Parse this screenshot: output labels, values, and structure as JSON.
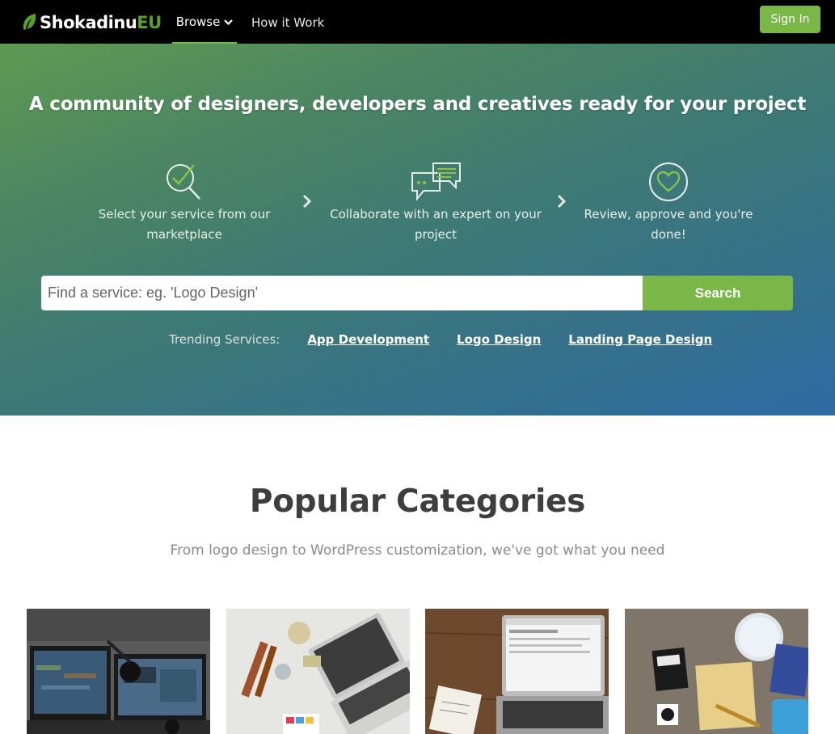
{
  "nav": {
    "logo_main": "Shokadinu",
    "logo_accent": "EU",
    "browse_label": "Browse",
    "how_label": "How it Work",
    "signin_label": "Sign In"
  },
  "hero": {
    "title": "A community of designers, developers and creatives ready for your project",
    "steps": [
      {
        "text": "Select your service from our marketplace",
        "icon": "search-check-icon"
      },
      {
        "text": "Collaborate with an expert on your project",
        "icon": "chat-bubbles-icon"
      },
      {
        "text": "Review, approve and you're done!",
        "icon": "heart-circle-icon"
      }
    ],
    "search_placeholder": "Find a service: eg. 'Logo Design'",
    "search_button": "Search",
    "trending_label": "Trending Services:",
    "trending_links": [
      "App Development",
      "Logo Design",
      "Landing Page Design"
    ]
  },
  "categories": {
    "title": "Popular Categories",
    "subtitle": "From logo design to WordPress customization, we've got what you need"
  },
  "colors": {
    "accent": "#7ab648",
    "navbar": "#000000",
    "hero_start": "#5f9a52",
    "hero_end": "#2f6aa3"
  }
}
